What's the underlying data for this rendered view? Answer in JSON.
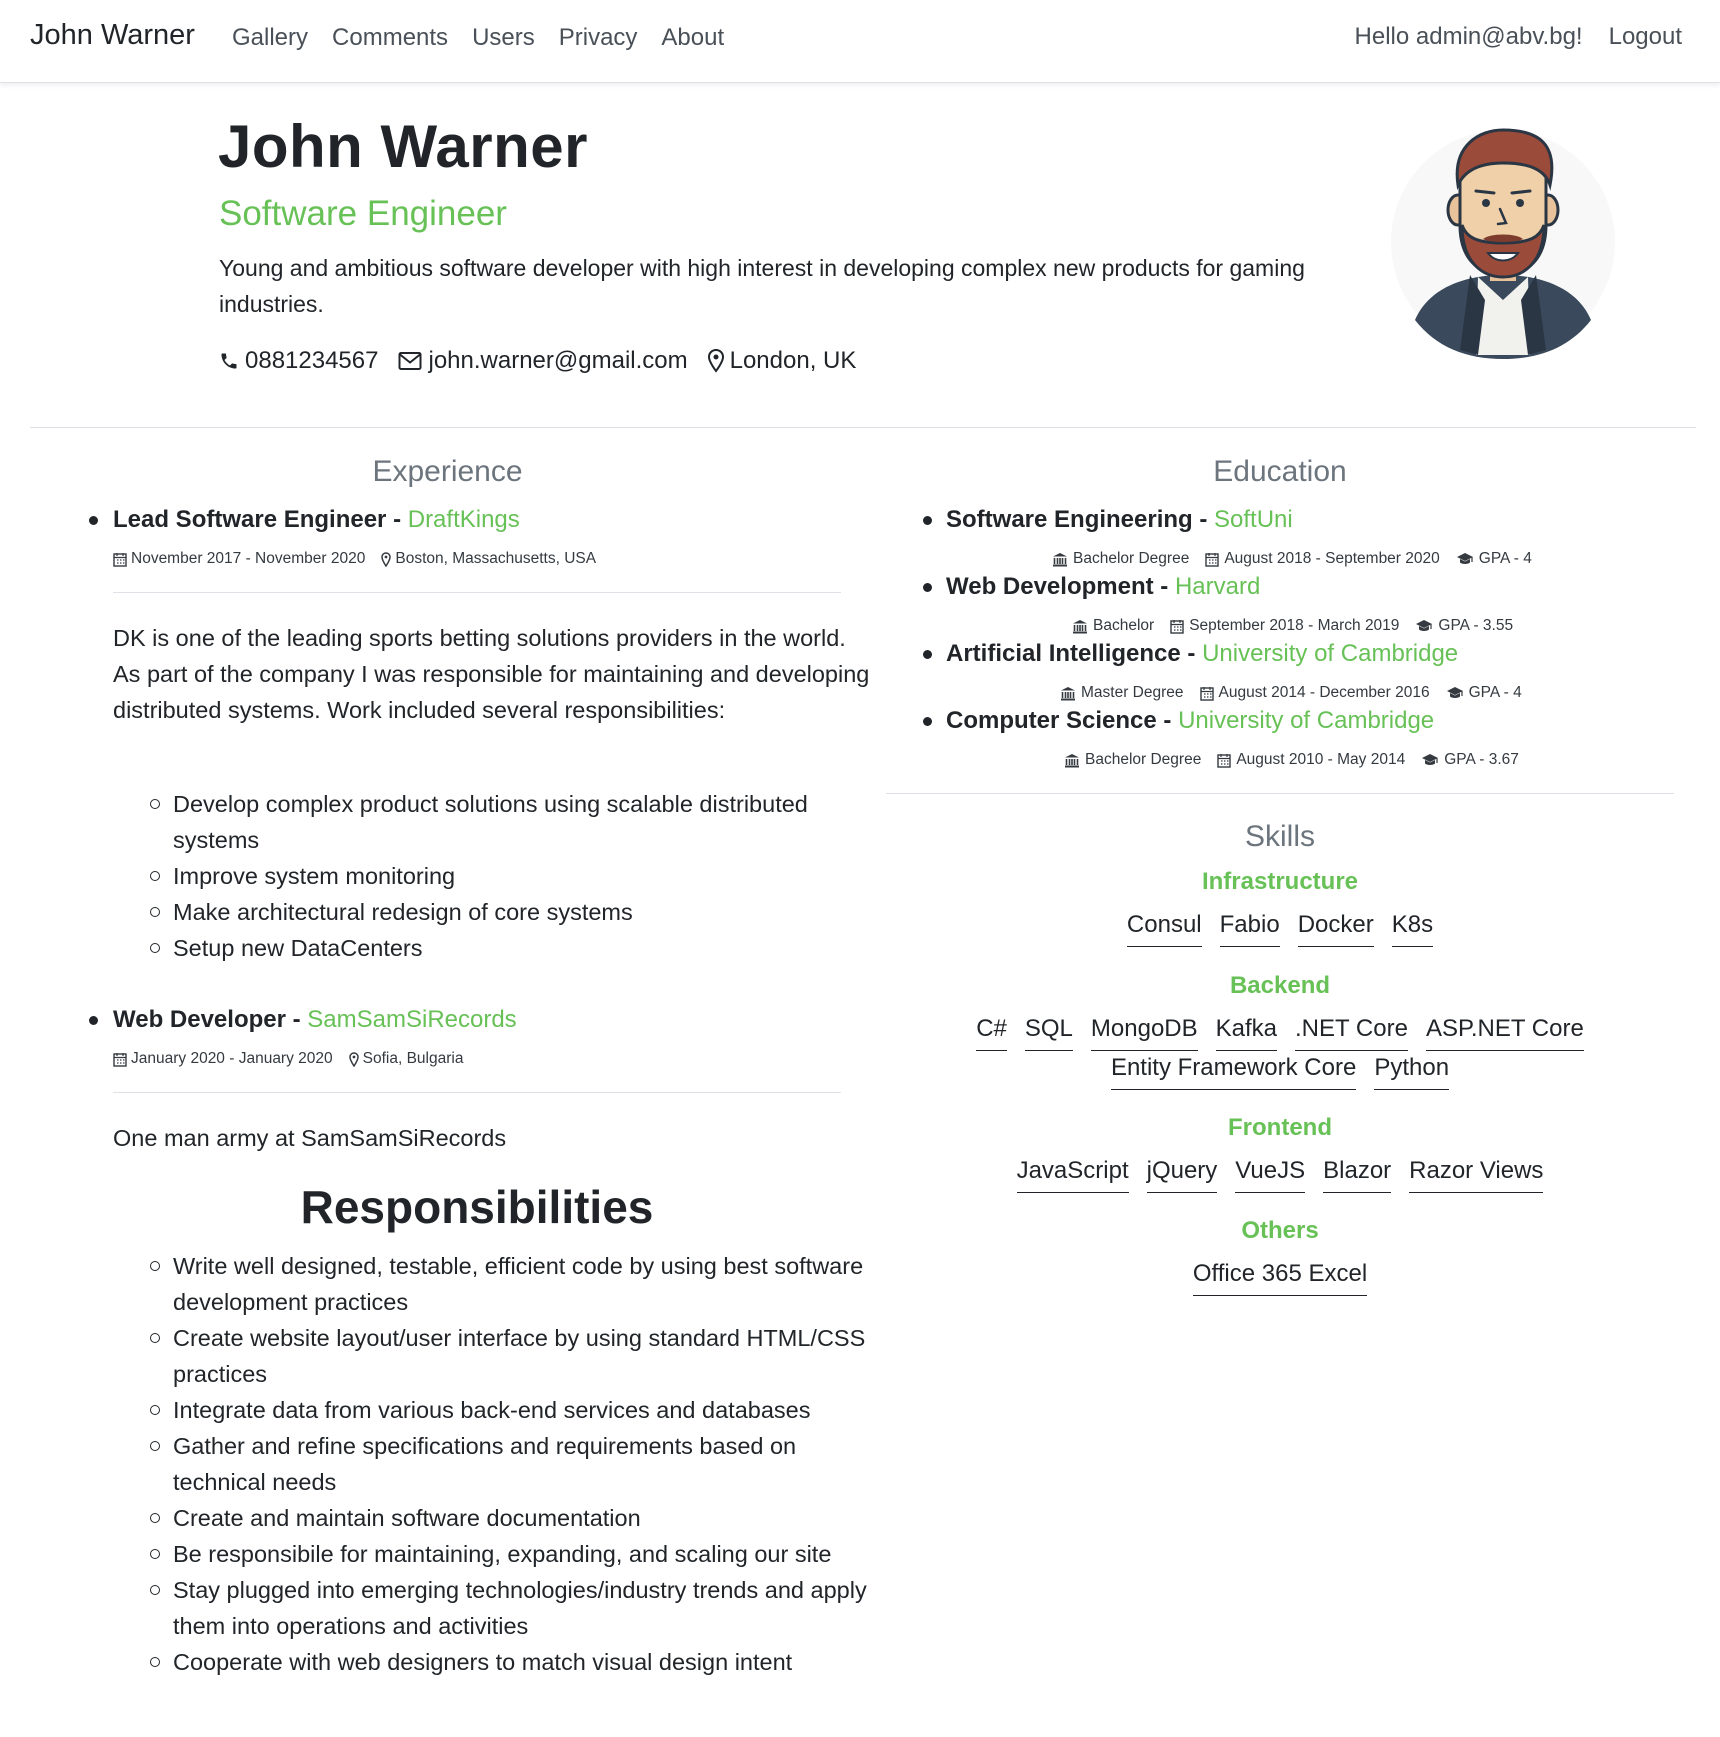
{
  "nav": {
    "brand": "John Warner",
    "links": [
      "Gallery",
      "Comments",
      "Users",
      "Privacy",
      "About"
    ],
    "greeting": "Hello admin@abv.bg!",
    "logout": "Logout"
  },
  "profile": {
    "name": "John Warner",
    "title": "Software Engineer",
    "description": "Young and ambitious software developer with high interest in developing complex new products for gaming industries.",
    "phone": "0881234567",
    "email": "john.warner@gmail.com",
    "location": "London, UK",
    "avatar_icon": "man-avatar-icon"
  },
  "experience": {
    "title": "Experience",
    "items": [
      {
        "position": "Lead Software Engineer",
        "separator": " - ",
        "company": "DraftKings",
        "dates": "November 2017 - November 2020",
        "location": "Boston, Massachusetts, USA",
        "description": "DK is one of the leading sports betting solutions providers in the world. As part of the company I was responsible for maintaining and developing distributed systems. Work included several responsibilities:",
        "bullets": [
          "Develop complex product solutions using scalable distributed systems",
          "Improve system monitoring",
          "Make architectural redesign of core systems",
          "Setup new DataCenters"
        ]
      },
      {
        "position": "Web Developer",
        "separator": " - ",
        "company": "SamSamSiRecords",
        "dates": "January 2020 - January 2020",
        "location": "Sofia, Bulgaria",
        "description": "One man army at SamSamSiRecords",
        "subheading": "Responsibilities",
        "bullets": [
          "Write well designed, testable, efficient code by using best software development practices",
          "Create website layout/user interface by using standard HTML/CSS practices",
          "Integrate data from various back-end services and databases",
          "Gather and refine specifications and requirements based on technical needs",
          "Create and maintain software documentation",
          "Be responsibile for maintaining, expanding, and scaling our site",
          "Stay plugged into emerging technologies/industry trends and apply them into operations and activities",
          "Cooperate with web designers to match visual design intent"
        ]
      }
    ]
  },
  "education": {
    "title": "Education",
    "items": [
      {
        "field": "Software Engineering",
        "separator": " - ",
        "school": "SoftUni",
        "degree": "Bachelor Degree",
        "dates": "August 2018 - September 2020",
        "gpa": "GPA - 4"
      },
      {
        "field": "Web Development",
        "separator": " - ",
        "school": "Harvard",
        "degree": "Bachelor",
        "dates": "September 2018 - March 2019",
        "gpa": "GPA - 3.55"
      },
      {
        "field": "Artificial Intelligence",
        "separator": " - ",
        "school": "University of Cambridge",
        "degree": "Master Degree",
        "dates": "August 2014 - December 2016",
        "gpa": "GPA - 4"
      },
      {
        "field": "Computer Science",
        "separator": " - ",
        "school": "University of Cambridge",
        "degree": "Bachelor Degree",
        "dates": "August 2010 - May 2014",
        "gpa": "GPA - 3.67"
      }
    ]
  },
  "skills": {
    "title": "Skills",
    "categories": [
      {
        "name": "Infrastructure",
        "items": [
          "Consul",
          "Fabio",
          "Docker",
          "K8s"
        ]
      },
      {
        "name": "Backend",
        "items": [
          "C#",
          "SQL",
          "MongoDB",
          "Kafka",
          ".NET Core",
          "ASP.NET Core",
          "Entity Framework Core",
          "Python"
        ]
      },
      {
        "name": "Frontend",
        "items": [
          "JavaScript",
          "jQuery",
          "VueJS",
          "Blazor",
          "Razor Views"
        ]
      },
      {
        "name": "Others",
        "items": [
          "Office 365 Excel"
        ]
      }
    ]
  },
  "colors": {
    "accent": "#67c156",
    "text": "#212529",
    "muted": "#6c757d"
  }
}
